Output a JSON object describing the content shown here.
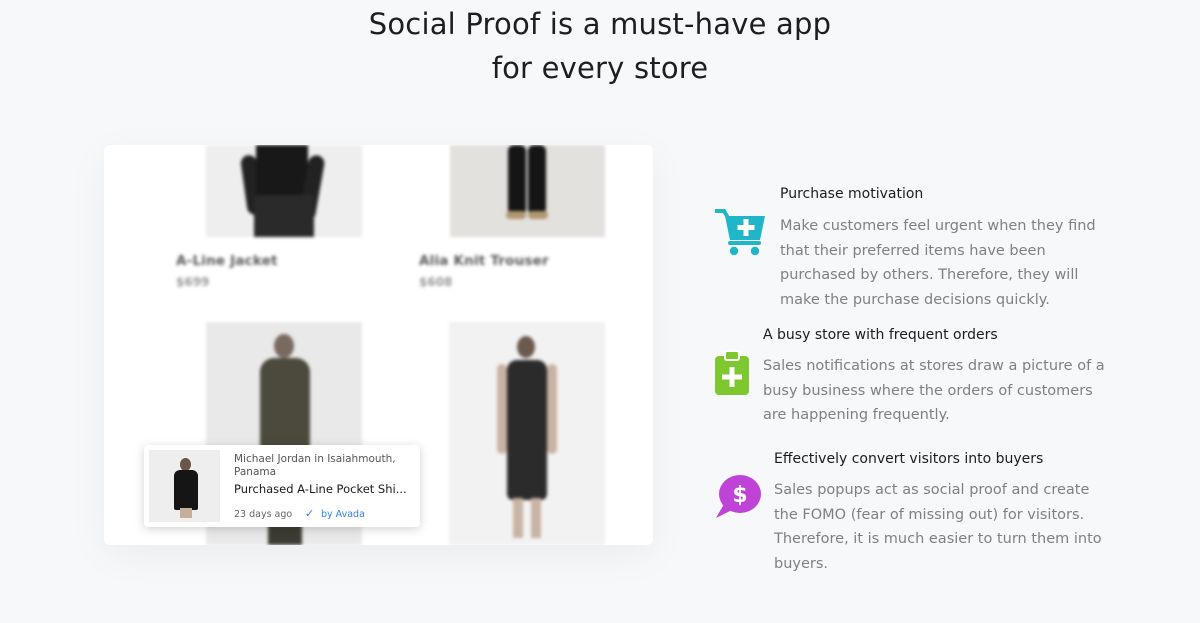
{
  "headline": {
    "line1": "Social Proof is a must-have app",
    "line2": "for every store"
  },
  "products": [
    {
      "name": "A-Line Jacket",
      "price": "$699"
    },
    {
      "name": "Alia Knit Trouser",
      "price": "$608"
    }
  ],
  "popup": {
    "customer_location": "Michael Jordan in Isaiahmouth, Panama",
    "product": "Purchased A-Line Pocket Shi...",
    "time": "23 days ago",
    "verified_icon": "check-icon",
    "by": "by Avada",
    "accent_color": "#2f80ed"
  },
  "features": [
    {
      "icon": "cart-plus-icon",
      "icon_color": "#1fb6c9",
      "title": "Purchase motivation",
      "desc": "Make customers feel urgent when they find that their preferred items have been purchased by others. Therefore, they will make the purchase decisions quickly."
    },
    {
      "icon": "clipboard-plus-icon",
      "icon_color": "#7cc82e",
      "title": "A busy store with frequent orders",
      "desc": "Sales notifications at stores draw a picture of a busy business where the orders of customers are happening frequently."
    },
    {
      "icon": "dollar-chat-icon",
      "icon_color": "#c043d8",
      "title": "Effectively convert visitors into buyers",
      "desc": "Sales popups act as social proof and create the FOMO (fear of missing out) for visitors. Therefore, it is much easier to turn them into buyers."
    }
  ]
}
